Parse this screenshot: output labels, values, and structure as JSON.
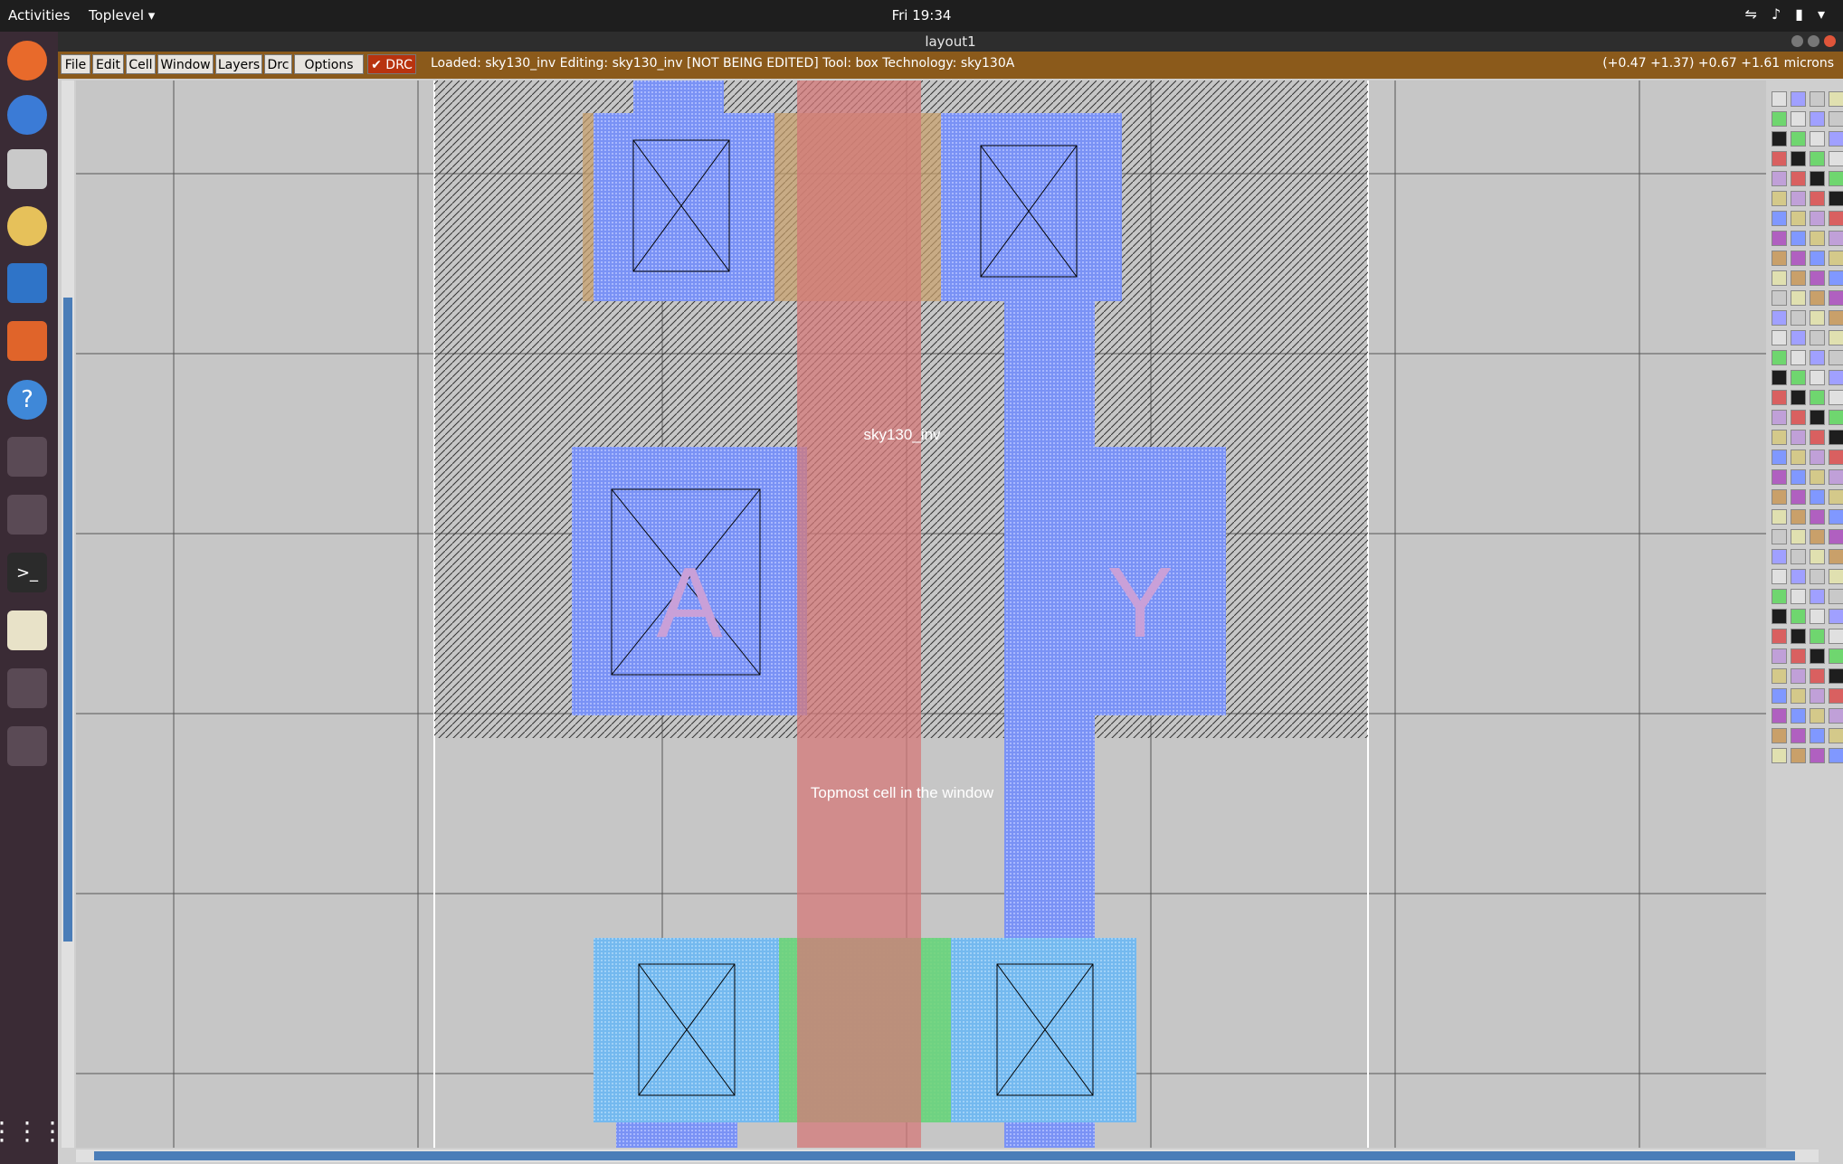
{
  "topbar": {
    "activities": "Activities",
    "app_menu": "Toplevel",
    "clock": "Fri 19:34"
  },
  "window": {
    "title": "layout1"
  },
  "menu": {
    "file": "File",
    "edit": "Edit",
    "cell": "Cell",
    "window": "Window",
    "layers": "Layers",
    "drc": "Drc",
    "options": "Options",
    "drc_toggle": "DRC"
  },
  "status": {
    "text": "Loaded: sky130_inv Editing: sky130_inv [NOT BEING EDITED] Tool: box  Technology: sky130A",
    "coords": "(+0.47 +1.37) +0.67 +1.61 microns"
  },
  "layout": {
    "cell_name": "sky130_inv",
    "top_cell_label": "Topmost cell in the window",
    "pin_a": "A",
    "pin_y": "Y"
  },
  "colors": {
    "titlebar": "#8b5a1b",
    "drc_button": "#b8330f",
    "canvas_bg": "#c6c6c6",
    "poly": "#d47878",
    "li": "#8098ff",
    "diff": "#7ac8f0",
    "nsdm": "#6fd66f"
  }
}
